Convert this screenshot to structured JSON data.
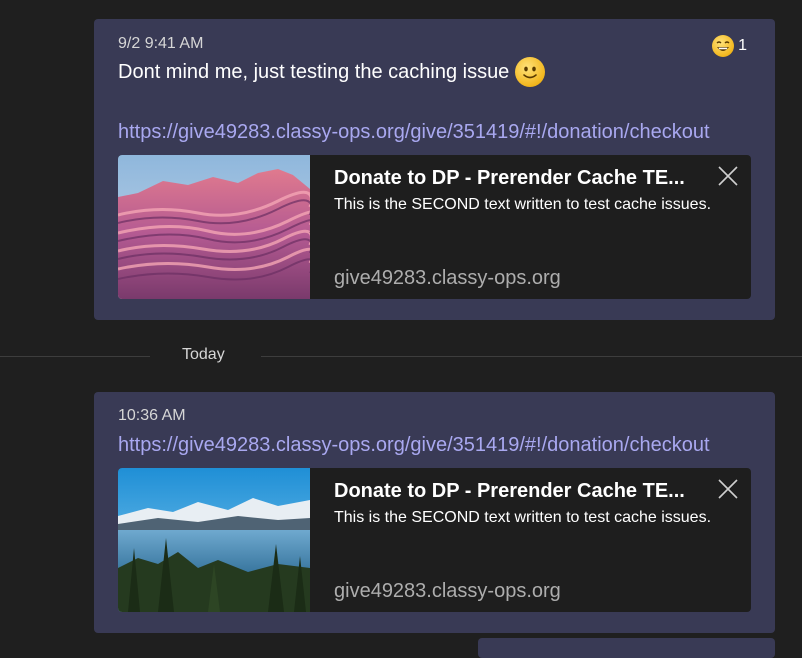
{
  "messages": [
    {
      "timestamp": "9/2 9:41 AM",
      "text": "Dont mind me, just testing the caching issue",
      "text_emoji": "slightly-smiling-face",
      "reaction": {
        "emoji": "grinning-face",
        "count": "1"
      },
      "link": "https://give49283.classy-ops.org/give/351419/#!/donation/checkout",
      "preview": {
        "title": "Donate to DP - Prerender Cache TE...",
        "description": "This is the SECOND text written to test cache issues.",
        "domain": "give49283.classy-ops.org",
        "image": "pink-layered-rock-cliff"
      }
    },
    {
      "timestamp": "10:36 AM",
      "link": "https://give49283.classy-ops.org/give/351419/#!/donation/checkout",
      "preview": {
        "title": "Donate to DP - Prerender Cache TE...",
        "description": "This is the SECOND text written to test cache issues.",
        "domain": "give49283.classy-ops.org",
        "image": "mountain-lake-landscape"
      }
    }
  ],
  "day_separator": "Today",
  "colors": {
    "background": "#1f1f1f",
    "bubble": "#393a55",
    "card": "#1e1e1e",
    "link": "#a9a8f0",
    "muted_text": "#adadad"
  }
}
